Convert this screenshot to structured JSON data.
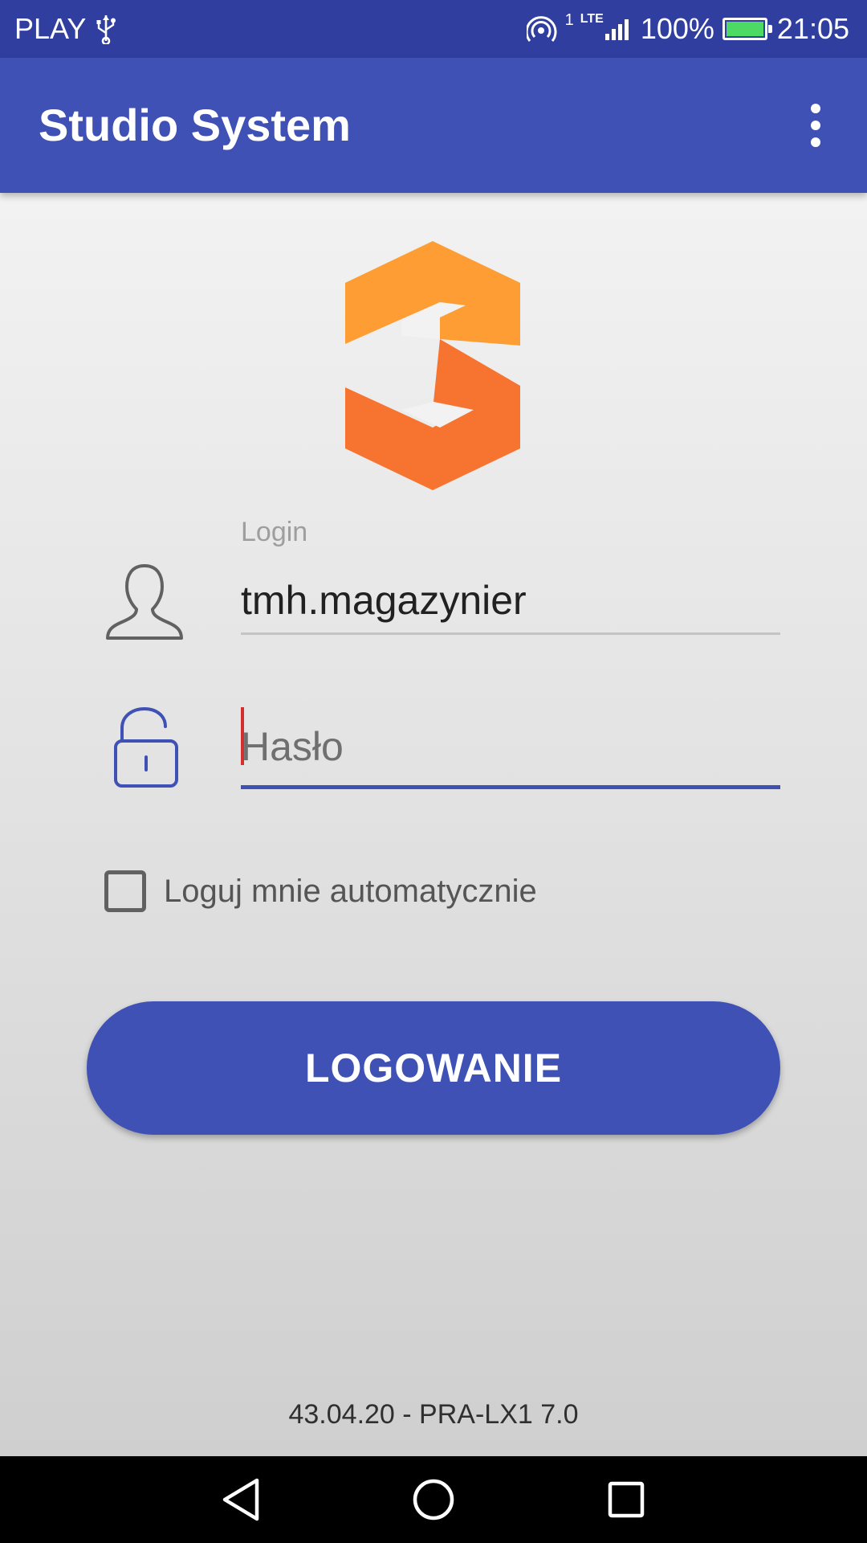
{
  "status_bar": {
    "carrier": "PLAY",
    "network": "LTE",
    "sim": "1",
    "battery_percent": "100%",
    "battery_level": 1.0,
    "time": "21:05"
  },
  "app_bar": {
    "title": "Studio System",
    "menu_icon": "overflow-menu-icon"
  },
  "logo": {
    "icon": "studio-system-logo",
    "colors": {
      "top": "#fd9d33",
      "bottom": "#f77430"
    }
  },
  "login_form": {
    "login_label": "Login",
    "login_value": "tmh.magazynier",
    "password_placeholder": "Hasło",
    "auto_login_label": "Loguj mnie automatycznie",
    "auto_login_checked": false,
    "submit_label": "LOGOWANIE"
  },
  "footer": {
    "version": "43.04.20 - PRA-LX1 7.0"
  },
  "colors": {
    "primary": "#3f51b5",
    "primary_dark": "#303f9f",
    "caret": "#d32f2f"
  },
  "nav_bar": {
    "back_icon": "back-icon",
    "home_icon": "home-icon",
    "recents_icon": "recents-icon"
  }
}
